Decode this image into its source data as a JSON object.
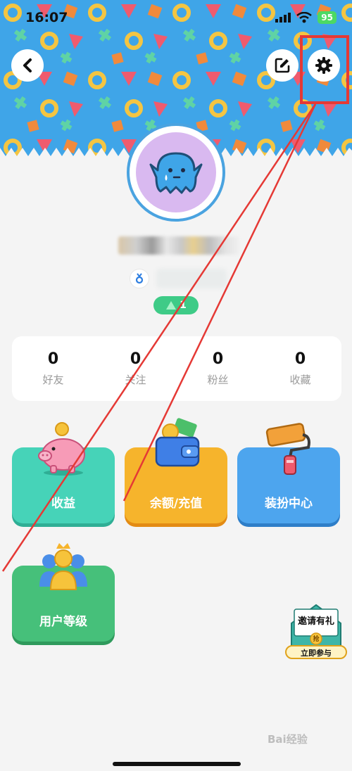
{
  "status_bar": {
    "time": "16:07",
    "battery": "95"
  },
  "header": {
    "back_icon": "chevron-left-icon",
    "edit_icon": "edit-icon",
    "settings_icon": "gear-icon"
  },
  "profile": {
    "avatar_icon": "ghost-icon",
    "level": "1"
  },
  "stats": [
    {
      "value": "0",
      "label": "好友"
    },
    {
      "value": "0",
      "label": "关注"
    },
    {
      "value": "0",
      "label": "粉丝"
    },
    {
      "value": "0",
      "label": "收藏"
    }
  ],
  "tiles": [
    {
      "label": "收益",
      "color": "#46d3b8",
      "icon": "piggy-bank-icon"
    },
    {
      "label": "余额/充值",
      "color": "#f6b42c",
      "icon": "wallet-icon"
    },
    {
      "label": "装扮中心",
      "color": "#4da5ee",
      "icon": "paint-roller-icon"
    },
    {
      "label": "用户等级",
      "color": "#46c07a",
      "icon": "crown-users-icon"
    }
  ],
  "invite": {
    "title": "邀请有礼",
    "badge": "抢",
    "button": "立即参与"
  },
  "watermark": "Bai经验",
  "colors": {
    "banner": "#3fa5e8",
    "annotation": "#e53935"
  }
}
